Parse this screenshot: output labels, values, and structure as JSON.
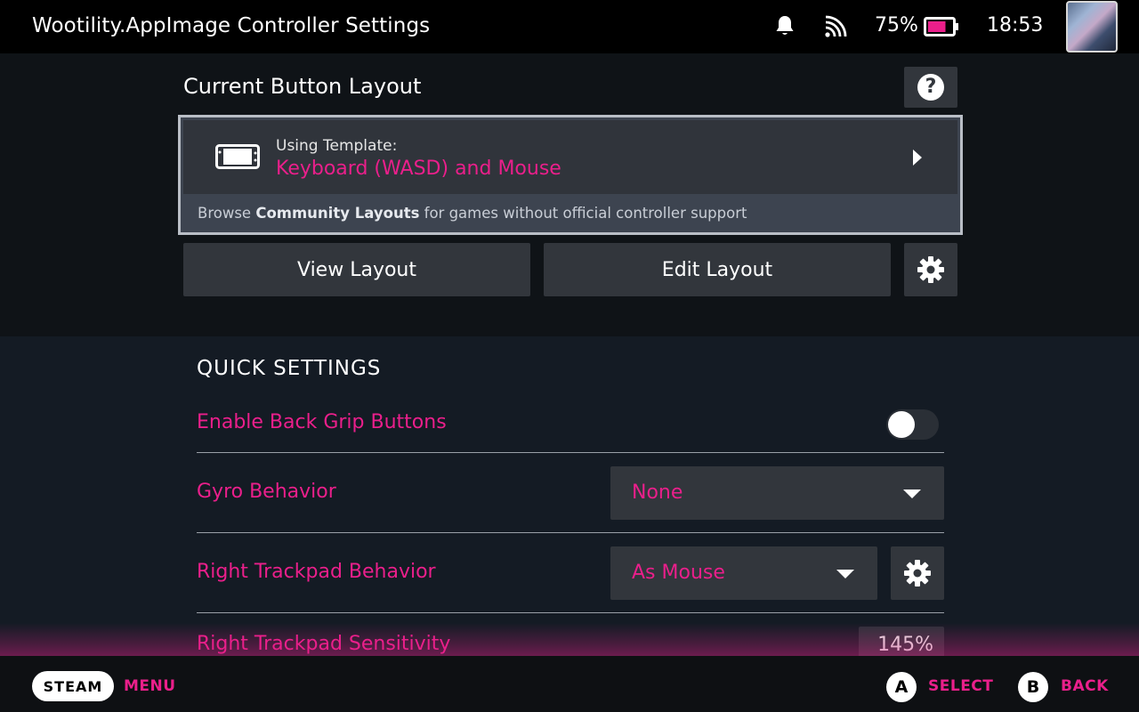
{
  "topbar": {
    "title": "Wootility.AppImage Controller Settings",
    "icons": [
      "bell-icon",
      "cast-icon",
      "battery-icon"
    ],
    "battery_percent": "75%",
    "battery_level": 0.75,
    "time": "18:53"
  },
  "layout": {
    "section_title": "Current Button Layout",
    "help_label": "?",
    "template_label": "Using Template:",
    "template_name": "Keyboard (WASD) and Mouse",
    "browse_prefix": "Browse",
    "browse_bold": "Community Layouts",
    "browse_suffix": "for games without official controller support",
    "view_button": "View Layout",
    "edit_button": "Edit Layout"
  },
  "quick_settings": {
    "title": "QUICK SETTINGS",
    "back_grip_label": "Enable Back Grip Buttons",
    "back_grip_enabled": false,
    "gyro_label": "Gyro Behavior",
    "gyro_value": "None",
    "trackpad_label": "Right Trackpad Behavior",
    "trackpad_value": "As Mouse",
    "sensitivity_label": "Right Trackpad Sensitivity",
    "sensitivity_value": "145%"
  },
  "bottombar": {
    "steam_label": "STEAM",
    "menu_label": "MENU",
    "a_button": "A",
    "select_label": "SELECT",
    "b_button": "B",
    "back_label": "BACK"
  },
  "colors": {
    "accent": "#ea1f8b",
    "panel": "#32363c",
    "background": "#0f1317"
  }
}
